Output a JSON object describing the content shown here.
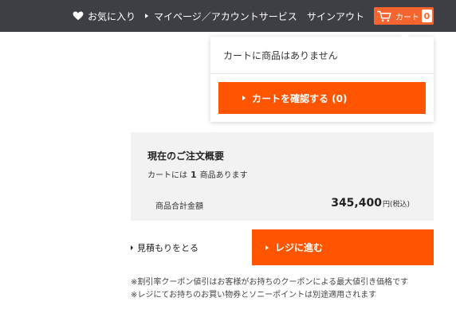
{
  "header": {
    "favorites_label": "お気に入り",
    "mypage_label": "マイページ／アカウントサービス",
    "signout_label": "サインアウト",
    "cart_label": "カート",
    "cart_count": "0"
  },
  "cart_dropdown": {
    "empty_message": "カートに商品はありません",
    "confirm_button": "カートを確認する (0)"
  },
  "order_summary": {
    "title": "現在のご注文概要",
    "count_prefix": "カートには",
    "count": "1",
    "count_suffix": "商品あります",
    "total_label": "商品合計金額",
    "total_amount": "345,400",
    "total_unit": "円(税込)"
  },
  "actions": {
    "estimate_label": "見積もりをとる",
    "checkout_label": "レジに進む"
  },
  "notes": [
    "※割引率クーポン値引はお客様がお持ちのクーポンによる最大値引き価格です",
    "※レジにてお持ちのお買い物券とソニーポイントは別途適用されます"
  ],
  "colors": {
    "topbar": "#3d3f44",
    "accent": "#ff5500",
    "summary_bg": "#f2f2f3"
  }
}
